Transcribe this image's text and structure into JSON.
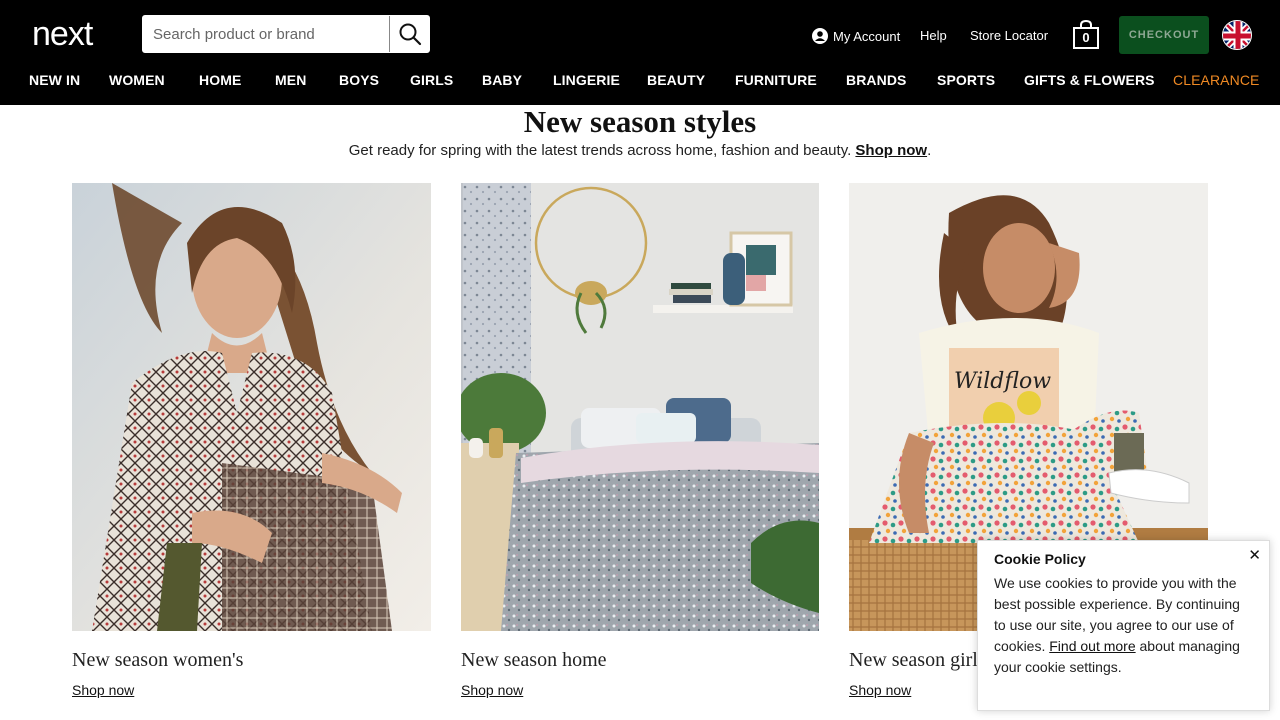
{
  "header": {
    "logo_text": "next",
    "search": {
      "placeholder": "Search product or brand"
    },
    "account_label": "My Account",
    "help_label": "Help",
    "store_locator_label": "Store Locator",
    "bag_count": "0",
    "checkout_label": "CHECKOUT",
    "accent_colors": {
      "checkout_bg": "#0b4f1e",
      "clearance": "#f08a24"
    }
  },
  "nav": {
    "items": [
      "NEW IN",
      "WOMEN",
      "HOME",
      "MEN",
      "BOYS",
      "GIRLS",
      "BABY",
      "LINGERIE",
      "BEAUTY",
      "FURNITURE",
      "BRANDS",
      "SPORTS",
      "GIFTS & FLOWERS",
      "CLEARANCE"
    ]
  },
  "main": {
    "heading": "New season styles",
    "subline_text": "Get ready for spring with the latest trends across home, fashion and beauty.",
    "subline_link": "Shop now",
    "subline_end": ".",
    "cards": [
      {
        "caption": "New season women's",
        "link": "Shop now",
        "image": "woman-in-patterned-dress"
      },
      {
        "caption": "New season home",
        "link": "Shop now",
        "image": "bedroom-with-grey-bedding"
      },
      {
        "caption": "New season girls",
        "link": "Shop now",
        "image": "girl-in-wildflower-tshirt"
      }
    ]
  },
  "cookie": {
    "title": "Cookie Policy",
    "body": "We use cookies to provide you with the best possible experience. By continuing to use our site, you agree to our use of cookies.",
    "link": "Find out more",
    "body_end": " about managing your cookie settings.",
    "close_icon": "close-icon"
  }
}
